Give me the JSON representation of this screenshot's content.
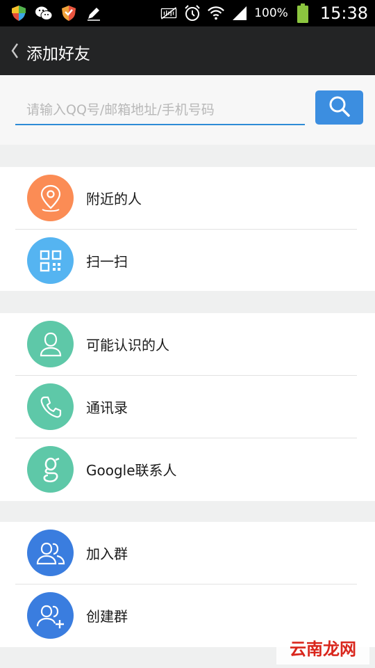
{
  "status_bar": {
    "battery": "100%",
    "time": "15:38",
    "left_icons": [
      "shield-icon",
      "wechat-icon",
      "shield-icon",
      "pen-icon"
    ],
    "right_icons": [
      "mute-icon",
      "alarm-icon",
      "wifi-icon",
      "signal-icon",
      "battery-icon"
    ]
  },
  "header": {
    "back_icon": "chevron-left-icon",
    "title": "添加好友"
  },
  "search": {
    "placeholder": "请输入QQ号/邮箱地址/手机号码",
    "value": "",
    "button_icon": "search-icon"
  },
  "groups": [
    {
      "items": [
        {
          "label": "附近的人",
          "icon": "location-pin-icon",
          "color": "#fb8c55"
        },
        {
          "label": "扫一扫",
          "icon": "qr-code-icon",
          "color": "#55b4f1"
        }
      ]
    },
    {
      "items": [
        {
          "label": "可能认识的人",
          "icon": "person-icon",
          "color": "#5ec8a8"
        },
        {
          "label": "通讯录",
          "icon": "phone-icon",
          "color": "#5ec8a8"
        },
        {
          "label": "Google联系人",
          "icon": "google-icon",
          "color": "#5ec8a8"
        }
      ]
    },
    {
      "items": [
        {
          "label": "加入群",
          "icon": "group-icon",
          "color": "#3a7ddf"
        },
        {
          "label": "创建群",
          "icon": "create-group-icon",
          "color": "#3a7ddf"
        }
      ]
    }
  ],
  "watermark": {
    "text": "云南龙网"
  },
  "colors": {
    "title_bar": "#232425",
    "accent": "#3c8ee0",
    "background": "#eff0f0"
  }
}
